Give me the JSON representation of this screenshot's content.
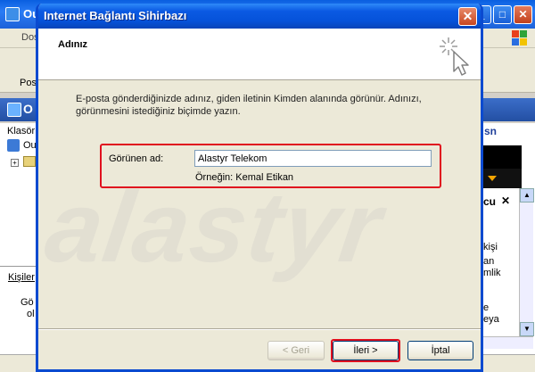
{
  "background_window": {
    "title": "Ou",
    "menu_fragment": "Dos",
    "toolbar_fragment": "Pos",
    "folder_header": "O",
    "left_pane_label": "Klasör",
    "tree_item": "Ou",
    "contacts_label": "Kişiler",
    "contacts_line1": "Gö",
    "contacts_line2": "ol",
    "msn_logo": "sn",
    "right_fragment_heading": "cu",
    "right_close": "✕",
    "right_text_lines": [
      "kişi",
      "an",
      "mlik",
      "e",
      "eya"
    ]
  },
  "wizard": {
    "title": "Internet Bağlantı Sihirbazı",
    "close_glyph": "✕",
    "heading": "Adınız",
    "description": "E-posta gönderdiğinizde adınız, giden iletinin Kimden alanında görünür. Adınızı, görünmesini istediğiniz biçimde yazın.",
    "display_name_label": "Görünen ad:",
    "display_name_value": "Alastyr Telekom",
    "example_text": "Örneğin: Kemal Etikan",
    "watermark": "alastyr",
    "buttons": {
      "back": "< Geri",
      "next": "İleri >",
      "cancel": "İptal"
    }
  },
  "colors": {
    "titlebar_blue": "#0552d9",
    "highlight_red": "#e0101e",
    "dialog_face": "#ece9d8"
  },
  "icons": [
    "app-icon",
    "minimize-icon",
    "maximize-icon",
    "close-icon",
    "windows-logo-icon",
    "folder-icon",
    "magic-wand-icon",
    "scroll-up-icon",
    "scroll-down-icon"
  ]
}
